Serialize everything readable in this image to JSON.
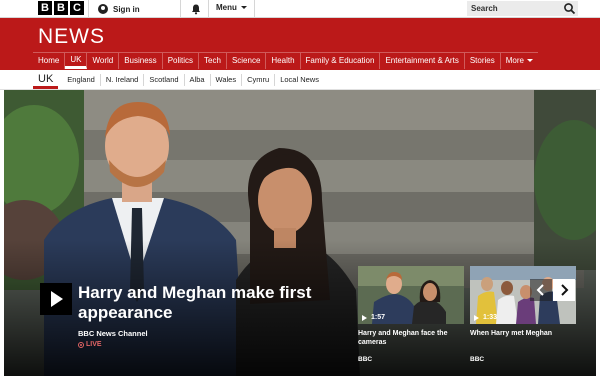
{
  "topbar": {
    "logo": [
      "B",
      "B",
      "C"
    ],
    "signin_label": "Sign in",
    "menu_label": "Menu",
    "search_placeholder": "Search",
    "icons": [
      "user-icon",
      "bell-icon",
      "chevron-down-icon",
      "search-icon"
    ]
  },
  "banner": {
    "title": "NEWS",
    "nav": [
      "Home",
      "UK",
      "World",
      "Business",
      "Politics",
      "Tech",
      "Science",
      "Health",
      "Family & Education",
      "Entertainment & Arts",
      "Stories",
      "More"
    ],
    "active": "UK"
  },
  "subnav": {
    "current": "UK",
    "items": [
      "England",
      "N. Ireland",
      "Scotland",
      "Alba",
      "Wales",
      "Cymru",
      "Local News"
    ]
  },
  "hero": {
    "headline": "Harry and Meghan make first appearance",
    "source": "BBC News Channel",
    "live_label": "LIVE",
    "cards": [
      {
        "duration": "1:57",
        "title": "Harry and Meghan face the cameras",
        "source": "BBC"
      },
      {
        "duration": "1:33",
        "title": "When Harry met Meghan",
        "source": "BBC"
      }
    ]
  },
  "colors": {
    "brand_red": "#bb1919",
    "live_red": "#e06464",
    "background": "#ffffff"
  }
}
